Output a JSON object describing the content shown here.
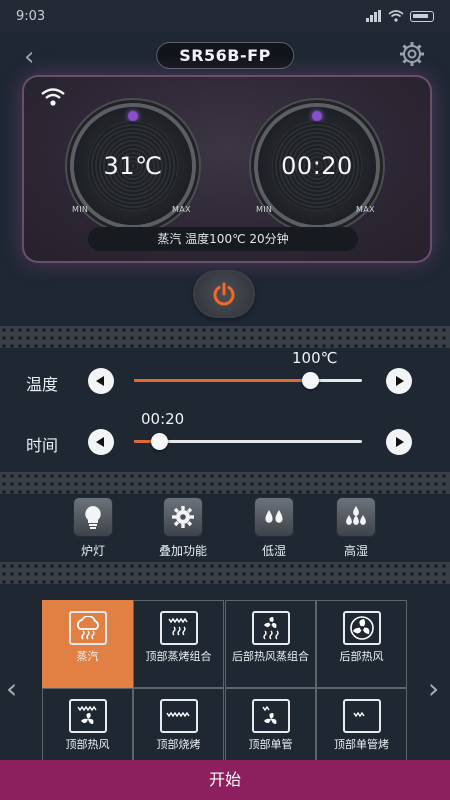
{
  "status_bar": {
    "time": "9:03"
  },
  "header": {
    "model": "SR56B-FP"
  },
  "panel": {
    "temperature_display": "31℃",
    "time_display": "00:20",
    "min_label": "MIN",
    "max_label": "MAX",
    "status_text": "蒸汽 温度100℃ 20分钟"
  },
  "controls": {
    "temperature": {
      "label": "温度",
      "value": "100℃",
      "fraction": 0.77
    },
    "time": {
      "label": "时间",
      "value": "00:20",
      "fraction": 0.11
    }
  },
  "features": [
    {
      "label": "炉灯",
      "icon": "lightbulb-icon"
    },
    {
      "label": "叠加功能",
      "icon": "gear-icon"
    },
    {
      "label": "低湿",
      "icon": "two-drops-icon"
    },
    {
      "label": "高湿",
      "icon": "many-drops-icon"
    }
  ],
  "modes": [
    {
      "label": "蒸汽",
      "icon": "steam-cloud-icon",
      "active": true
    },
    {
      "label": "顶部蒸烤组合",
      "icon": "top-steam-icon",
      "active": false
    },
    {
      "label": "后部热风蒸组合",
      "icon": "fan-steam-icon",
      "active": false
    },
    {
      "label": "后部热风",
      "icon": "fan-icon",
      "active": false
    },
    {
      "label": "顶部热风",
      "icon": "top-fan-icon",
      "active": false
    },
    {
      "label": "顶部烧烤",
      "icon": "grill-icon",
      "active": false
    },
    {
      "label": "顶部单管",
      "icon": "single-tube-fan-icon",
      "active": false
    },
    {
      "label": "顶部单管烤",
      "icon": "single-tube-icon",
      "active": false
    }
  ],
  "action": {
    "start_label": "开始"
  },
  "colors": {
    "accent": "#e27f43",
    "start_bar": "#8c1f5e",
    "background": "#1f2733"
  }
}
